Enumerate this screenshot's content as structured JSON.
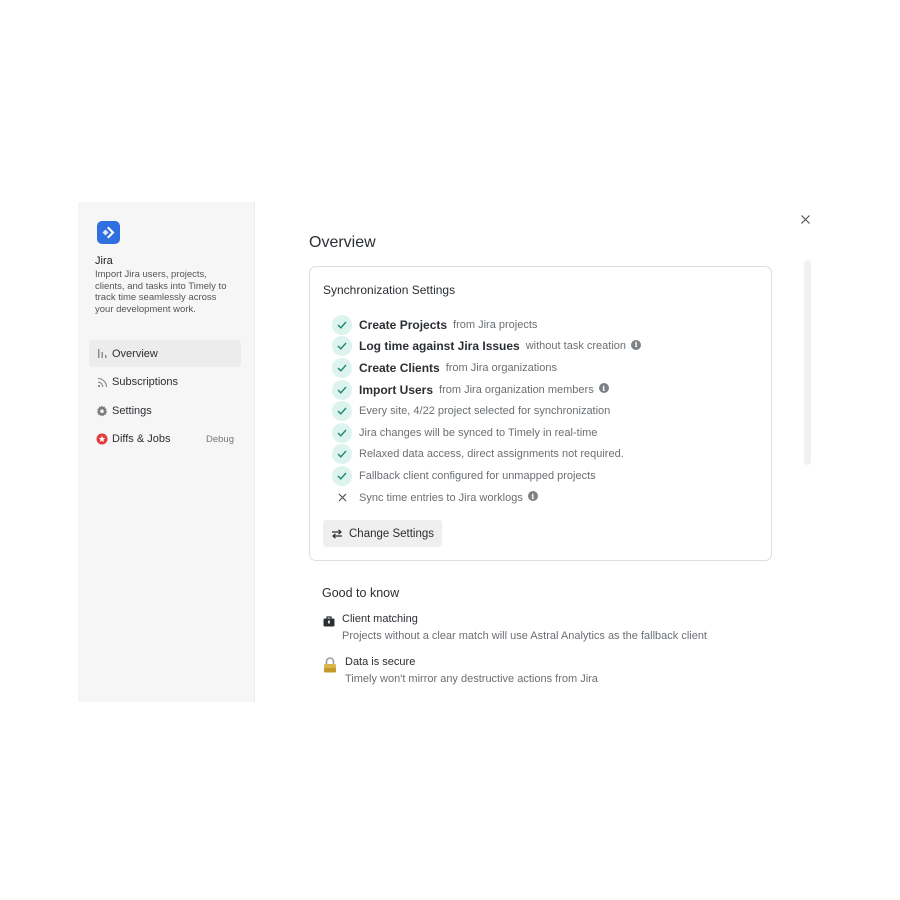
{
  "app": {
    "name": "Jira",
    "description": "Import Jira users, projects, clients, and tasks into Timely to track time seamlessly across your development work.",
    "logo_color": "#2f6fe0"
  },
  "nav": {
    "items": [
      {
        "label": "Overview",
        "icon": "bar-chart-icon",
        "active": true
      },
      {
        "label": "Subscriptions",
        "icon": "rss-icon"
      },
      {
        "label": "Settings",
        "icon": "gear-icon"
      },
      {
        "label": "Diffs & Jobs",
        "icon": "error-circle-icon",
        "badge": "Debug"
      }
    ]
  },
  "main": {
    "title": "Overview",
    "close_icon": "close-icon"
  },
  "sync": {
    "title": "Synchronization Settings",
    "features": [
      {
        "strong": "Create Projects",
        "text": "from Jira projects",
        "enabled": true
      },
      {
        "strong": "Log time against Jira Issues",
        "text": "without task creation",
        "enabled": true,
        "info": true
      },
      {
        "strong": "Create Clients",
        "text": "from Jira organizations",
        "enabled": true
      },
      {
        "strong": "Import Users",
        "text": "from Jira organization members",
        "enabled": true,
        "info": true
      },
      {
        "strong": "",
        "text": "Every site, 4/22 project selected for synchronization",
        "enabled": true
      },
      {
        "strong": "",
        "text": "Jira changes will be synced to Timely in real-time",
        "enabled": true
      },
      {
        "strong": "",
        "text": "Relaxed data access, direct assignments not required.",
        "enabled": true
      },
      {
        "strong": "",
        "text": "Fallback client configured for unmapped projects",
        "enabled": true
      },
      {
        "strong": "",
        "text": "Sync time entries to Jira worklogs",
        "enabled": false,
        "info": true
      }
    ],
    "change_button": "Change Settings",
    "check_color": "#ddf3ee",
    "check_mark_color": "#1f8a6e"
  },
  "good_to_know": {
    "title": "Good to know",
    "items": [
      {
        "icon": "briefcase-icon",
        "heading": "Client matching",
        "body": "Projects without a clear match will use Astral Analytics as the fallback client"
      },
      {
        "icon": "lock-icon",
        "heading": "Data is secure",
        "body": "Timely won't mirror any destructive actions from Jira"
      }
    ]
  }
}
